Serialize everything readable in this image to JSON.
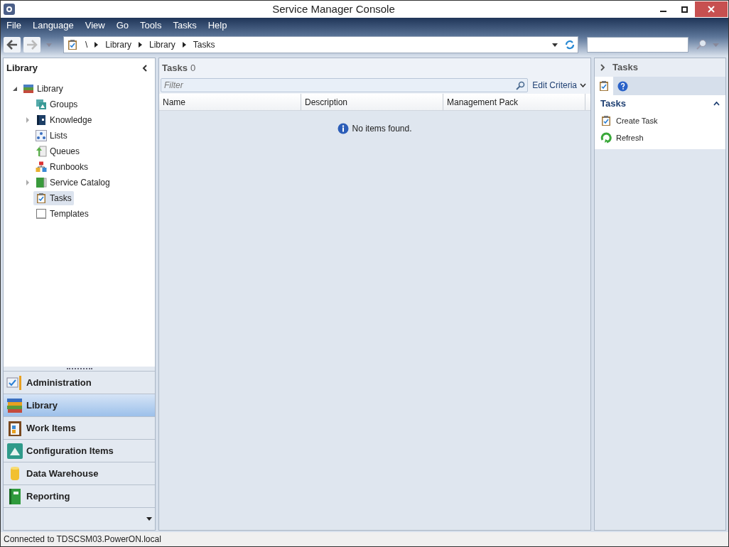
{
  "window": {
    "title": "Service Manager Console"
  },
  "menu": [
    "File",
    "Language",
    "View",
    "Go",
    "Tools",
    "Tasks",
    "Help"
  ],
  "breadcrumb": [
    "\\",
    "Library",
    "Library",
    "Tasks"
  ],
  "left_panel": {
    "title": "Library",
    "tree": [
      {
        "label": "Library",
        "expanded": true,
        "selected": false,
        "children": [
          {
            "label": "Groups",
            "selected": false
          },
          {
            "label": "Knowledge",
            "expanded": false,
            "selected": false
          },
          {
            "label": "Lists",
            "selected": false
          },
          {
            "label": "Queues",
            "selected": false
          },
          {
            "label": "Runbooks",
            "selected": false
          },
          {
            "label": "Service Catalog",
            "expanded": false,
            "selected": false
          },
          {
            "label": "Tasks",
            "selected": true
          },
          {
            "label": "Templates",
            "selected": false
          }
        ]
      }
    ]
  },
  "workspaces": [
    {
      "label": "Administration",
      "selected": false
    },
    {
      "label": "Library",
      "selected": true
    },
    {
      "label": "Work Items",
      "selected": false
    },
    {
      "label": "Configuration Items",
      "selected": false
    },
    {
      "label": "Data Warehouse",
      "selected": false
    },
    {
      "label": "Reporting",
      "selected": false
    }
  ],
  "center": {
    "title": "Tasks",
    "count": "0",
    "filter": {
      "placeholder": "Filter"
    },
    "edit_criteria": "Edit Criteria",
    "table": {
      "columns": [
        "Name",
        "Description",
        "Management Pack"
      ]
    },
    "empty_message": "No items found."
  },
  "right_panel": {
    "title": "Tasks",
    "tabs": [
      {
        "kind": "tasks",
        "selected": true
      },
      {
        "kind": "help",
        "selected": false
      }
    ],
    "section": {
      "title": "Tasks",
      "expanded": true,
      "actions": [
        "Create Task",
        "Refresh"
      ]
    }
  },
  "status_bar": "Connected to TDSCSM03.PowerON.local"
}
